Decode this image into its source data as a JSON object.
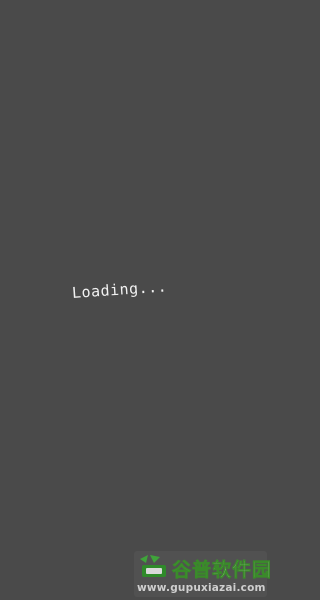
{
  "screen": {
    "background_color": "#4a4a4a",
    "loading_text": "Loading..."
  },
  "watermark": {
    "title_part1": "谷普",
    "title_part2": "软件园",
    "url": "www.gupuxiazai.com",
    "logo_icon": "gupu-logo-icon",
    "accent_color": "#3fa43a"
  }
}
